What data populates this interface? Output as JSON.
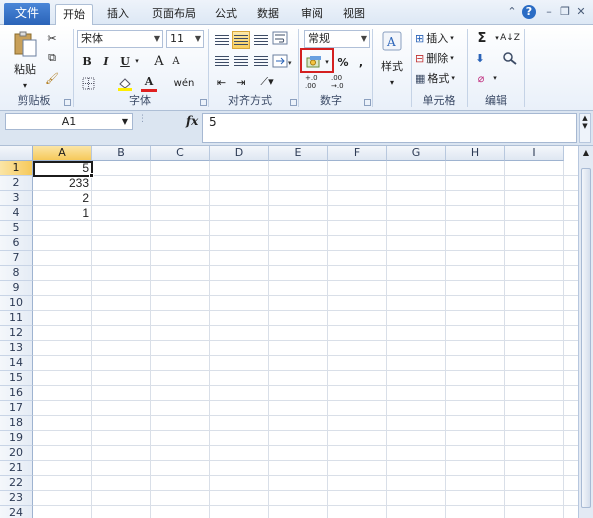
{
  "tabs": {
    "file": "文件",
    "items": [
      "开始",
      "插入",
      "页面布局",
      "公式",
      "数据",
      "审阅",
      "视图"
    ],
    "active": "开始"
  },
  "ribbon": {
    "clipboard": {
      "paste": "粘贴",
      "label": "剪贴板"
    },
    "font": {
      "name": "宋体",
      "size": "11",
      "bold": "B",
      "italic": "I",
      "underline": "U",
      "grow": "A",
      "shrink": "A",
      "font_color": "A",
      "wen": "wén",
      "label": "字体"
    },
    "alignment": {
      "label": "对齐方式"
    },
    "number": {
      "format": "常规",
      "percent": "%",
      "comma": ",",
      "inc_decimal": "+.0 .00",
      "dec_decimal": ".00 →.0",
      "label": "数字"
    },
    "styles": {
      "label": "样式"
    },
    "cells": {
      "insert": "插入",
      "delete": "删除",
      "format": "格式",
      "label": "单元格"
    },
    "editing": {
      "sum": "Σ",
      "sort": "A↓Z",
      "find": "A",
      "clear": "⌀",
      "label": "编辑"
    }
  },
  "formula_bar": {
    "name_box": "A1",
    "fx": "fx",
    "value": "5"
  },
  "grid": {
    "columns": [
      "A",
      "B",
      "C",
      "D",
      "E",
      "F",
      "G",
      "H",
      "I"
    ],
    "rows": [
      "1",
      "2",
      "3",
      "4",
      "5",
      "6",
      "7",
      "8",
      "9",
      "10",
      "11",
      "12",
      "13",
      "14",
      "15",
      "16",
      "17",
      "18",
      "19",
      "20",
      "21",
      "22",
      "23",
      "24"
    ],
    "selected_cell": "A1",
    "column_a_values": [
      "5",
      "233",
      "2",
      "1"
    ]
  },
  "colors": {
    "accent": "#2a63b8",
    "highlight_box": "#d42020",
    "selected_header": "#f6c95a"
  }
}
